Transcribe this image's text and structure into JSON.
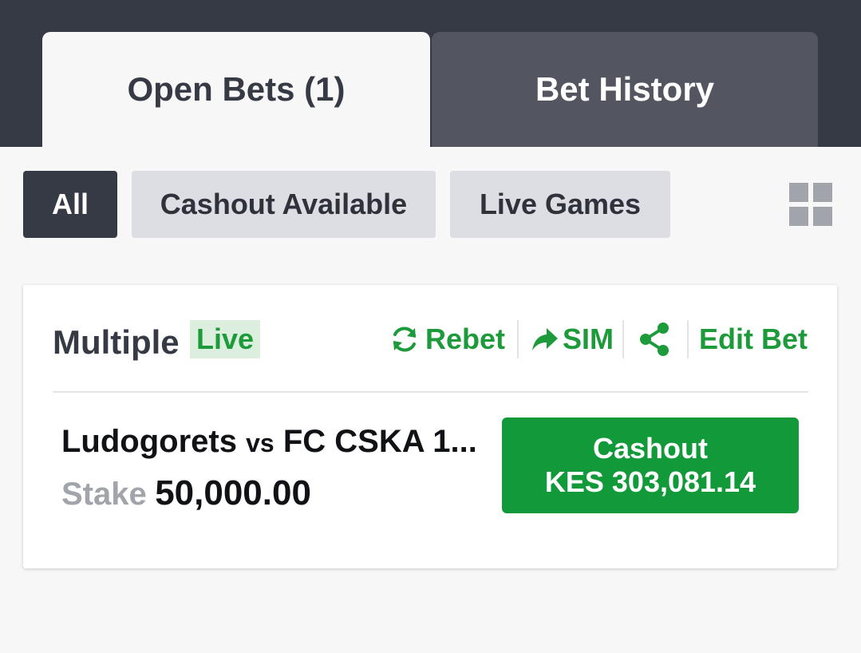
{
  "tabs": {
    "open_bets": "Open Bets (1)",
    "bet_history": "Bet History"
  },
  "filters": {
    "all": "All",
    "cashout_available": "Cashout Available",
    "live_games": "Live Games",
    "grid_icon": "grid-view-icon"
  },
  "bet": {
    "type": "Multiple",
    "live_badge": "Live",
    "actions": {
      "rebet": "Rebet",
      "sim": "SIM",
      "share_icon": "share-icon",
      "edit": "Edit Bet"
    },
    "match_home": "Ludogorets",
    "match_vs": "vs",
    "match_away": "FC CSKA 1...",
    "stake_label": "Stake",
    "stake_value": "50,000.00",
    "cashout_label": "Cashout",
    "cashout_amount": "KES 303,081.14"
  },
  "colors": {
    "accent_green": "#12993a",
    "dark": "#363a45"
  }
}
